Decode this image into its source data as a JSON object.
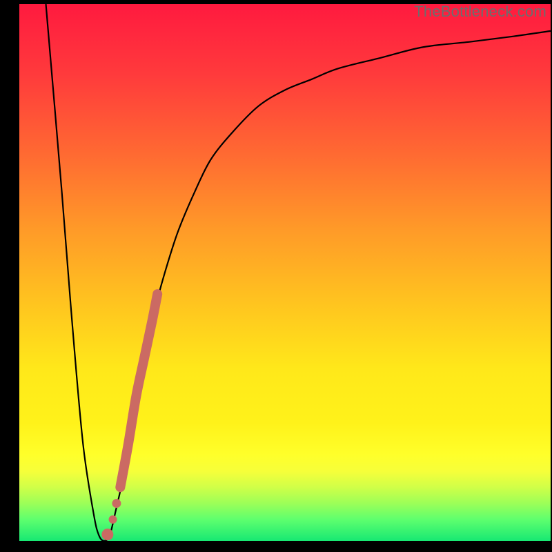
{
  "watermark": "TheBottleneck.com",
  "colors": {
    "background": "#000000",
    "curve": "#000000",
    "marker": "#cb6a63",
    "gradient_top": "#ff1a3f",
    "gradient_bottom": "#17e873"
  },
  "chart_data": {
    "type": "line",
    "title": "",
    "xlabel": "",
    "ylabel": "",
    "xlim": [
      0,
      100
    ],
    "ylim": [
      0,
      100
    ],
    "grid": false,
    "series": [
      {
        "name": "bottleneck-curve",
        "x": [
          5,
          8,
          10,
          12,
          14,
          15,
          16,
          17,
          18,
          20,
          22,
          24,
          26,
          28,
          30,
          33,
          36,
          40,
          45,
          50,
          55,
          60,
          68,
          76,
          85,
          93,
          100
        ],
        "y": [
          100,
          65,
          40,
          18,
          5,
          1,
          0,
          1,
          5,
          14,
          26,
          36,
          45,
          52,
          58,
          65,
          71,
          76,
          81,
          84,
          86,
          88,
          90,
          92,
          93,
          94,
          95
        ]
      }
    ],
    "annotations": [
      {
        "name": "highlight-marker",
        "shape": "exclamation-dotted",
        "x_range": [
          17.5,
          25.5
        ],
        "y_range": [
          2,
          45
        ],
        "color": "#cb6a63"
      }
    ]
  }
}
